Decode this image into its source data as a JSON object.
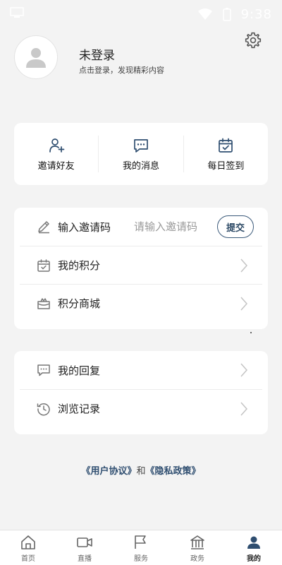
{
  "status_bar": {
    "time": "9:38"
  },
  "profile": {
    "title": "未登录",
    "subtitle": "点击登录，发现精彩内容"
  },
  "quick_actions": [
    {
      "label": "邀请好友",
      "icon": "add-user-icon"
    },
    {
      "label": "我的消息",
      "icon": "message-icon"
    },
    {
      "label": "每日签到",
      "icon": "calendar-check-icon"
    }
  ],
  "invite": {
    "label": "输入邀请码",
    "placeholder": "请输入邀请码",
    "submit_label": "提交"
  },
  "list1": [
    {
      "label": "我的积分",
      "icon": "calendar-check-icon"
    },
    {
      "label": "积分商城",
      "icon": "gift-box-icon"
    }
  ],
  "list2": [
    {
      "label": "我的回复",
      "icon": "comment-icon"
    },
    {
      "label": "浏览记录",
      "icon": "history-icon"
    }
  ],
  "agreement": {
    "user_agreement": "《用户协议》",
    "and": "和",
    "privacy_policy": "《隐私政策》"
  },
  "tabs": [
    {
      "label": "首页",
      "icon": "home-icon"
    },
    {
      "label": "直播",
      "icon": "video-icon"
    },
    {
      "label": "服务",
      "icon": "flag-icon"
    },
    {
      "label": "政务",
      "icon": "building-icon"
    },
    {
      "label": "我的",
      "icon": "user-icon",
      "active": true
    }
  ],
  "colors": {
    "accent": "#2f4e70",
    "background": "#f3f3f3"
  }
}
